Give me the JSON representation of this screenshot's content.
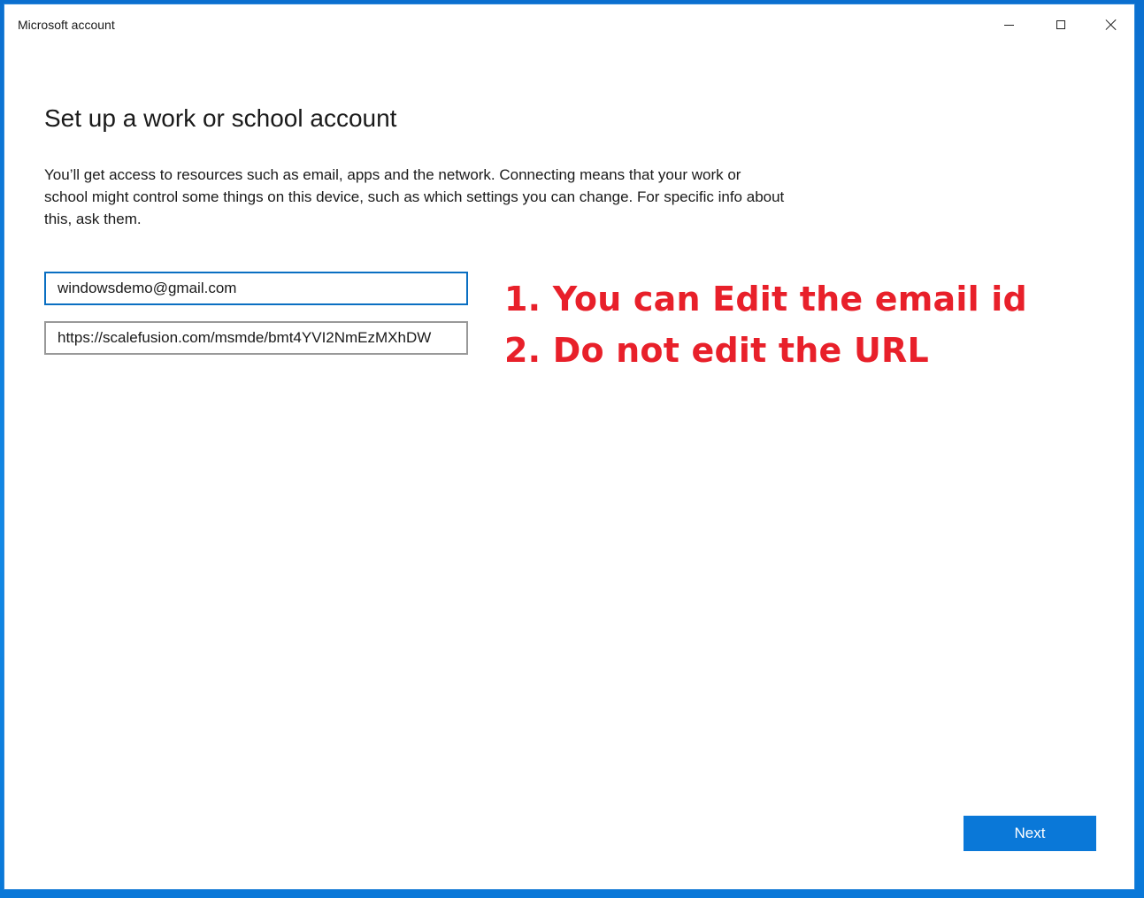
{
  "window": {
    "title": "Microsoft account",
    "controls": {
      "minimize": "minimize-icon",
      "maximize": "maximize-icon",
      "close": "close-icon"
    }
  },
  "content": {
    "heading": "Set up a work or school account",
    "description": "You’ll get access to resources such as email, apps and the network. Connecting means that your work or school might control some things on this device, such as which settings you can change. For specific info about this, ask them.",
    "email_value": "windowsdemo@gmail.com",
    "url_value": "https://scalefusion.com/msmde/bmt4YVI2NmEzMXhDW",
    "next_label": "Next"
  },
  "annotations": {
    "line1": "1. You can Edit the email id",
    "line2": "2. Do not edit the URL"
  },
  "colors": {
    "accent": "#0a78d8",
    "annotation": "#e8202a",
    "focused_border": "#0a6fc2",
    "field_border": "#999999"
  }
}
